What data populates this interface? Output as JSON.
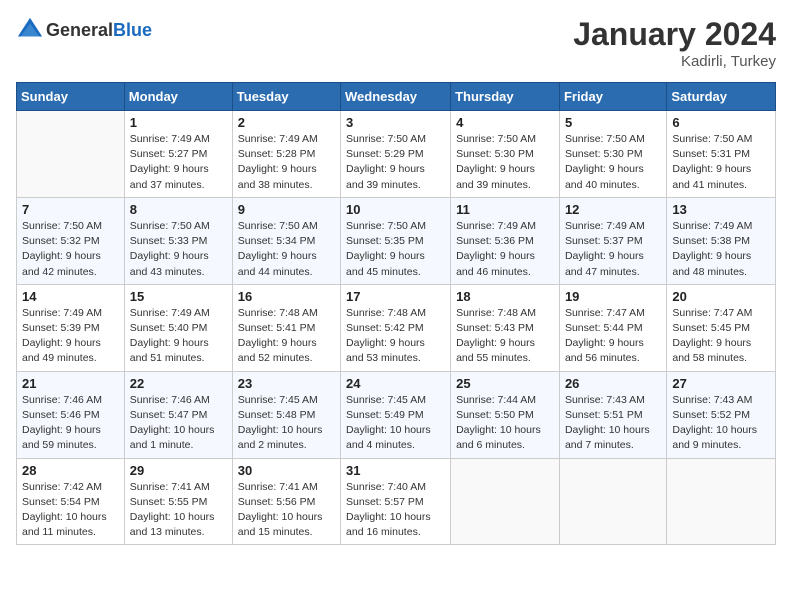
{
  "header": {
    "logo_general": "General",
    "logo_blue": "Blue",
    "title": "January 2024",
    "location": "Kadirli, Turkey"
  },
  "weekdays": [
    "Sunday",
    "Monday",
    "Tuesday",
    "Wednesday",
    "Thursday",
    "Friday",
    "Saturday"
  ],
  "weeks": [
    [
      {
        "day": "",
        "info": ""
      },
      {
        "day": "1",
        "info": "Sunrise: 7:49 AM\nSunset: 5:27 PM\nDaylight: 9 hours\nand 37 minutes."
      },
      {
        "day": "2",
        "info": "Sunrise: 7:49 AM\nSunset: 5:28 PM\nDaylight: 9 hours\nand 38 minutes."
      },
      {
        "day": "3",
        "info": "Sunrise: 7:50 AM\nSunset: 5:29 PM\nDaylight: 9 hours\nand 39 minutes."
      },
      {
        "day": "4",
        "info": "Sunrise: 7:50 AM\nSunset: 5:30 PM\nDaylight: 9 hours\nand 39 minutes."
      },
      {
        "day": "5",
        "info": "Sunrise: 7:50 AM\nSunset: 5:30 PM\nDaylight: 9 hours\nand 40 minutes."
      },
      {
        "day": "6",
        "info": "Sunrise: 7:50 AM\nSunset: 5:31 PM\nDaylight: 9 hours\nand 41 minutes."
      }
    ],
    [
      {
        "day": "7",
        "info": "Sunrise: 7:50 AM\nSunset: 5:32 PM\nDaylight: 9 hours\nand 42 minutes."
      },
      {
        "day": "8",
        "info": "Sunrise: 7:50 AM\nSunset: 5:33 PM\nDaylight: 9 hours\nand 43 minutes."
      },
      {
        "day": "9",
        "info": "Sunrise: 7:50 AM\nSunset: 5:34 PM\nDaylight: 9 hours\nand 44 minutes."
      },
      {
        "day": "10",
        "info": "Sunrise: 7:50 AM\nSunset: 5:35 PM\nDaylight: 9 hours\nand 45 minutes."
      },
      {
        "day": "11",
        "info": "Sunrise: 7:49 AM\nSunset: 5:36 PM\nDaylight: 9 hours\nand 46 minutes."
      },
      {
        "day": "12",
        "info": "Sunrise: 7:49 AM\nSunset: 5:37 PM\nDaylight: 9 hours\nand 47 minutes."
      },
      {
        "day": "13",
        "info": "Sunrise: 7:49 AM\nSunset: 5:38 PM\nDaylight: 9 hours\nand 48 minutes."
      }
    ],
    [
      {
        "day": "14",
        "info": "Sunrise: 7:49 AM\nSunset: 5:39 PM\nDaylight: 9 hours\nand 49 minutes."
      },
      {
        "day": "15",
        "info": "Sunrise: 7:49 AM\nSunset: 5:40 PM\nDaylight: 9 hours\nand 51 minutes."
      },
      {
        "day": "16",
        "info": "Sunrise: 7:48 AM\nSunset: 5:41 PM\nDaylight: 9 hours\nand 52 minutes."
      },
      {
        "day": "17",
        "info": "Sunrise: 7:48 AM\nSunset: 5:42 PM\nDaylight: 9 hours\nand 53 minutes."
      },
      {
        "day": "18",
        "info": "Sunrise: 7:48 AM\nSunset: 5:43 PM\nDaylight: 9 hours\nand 55 minutes."
      },
      {
        "day": "19",
        "info": "Sunrise: 7:47 AM\nSunset: 5:44 PM\nDaylight: 9 hours\nand 56 minutes."
      },
      {
        "day": "20",
        "info": "Sunrise: 7:47 AM\nSunset: 5:45 PM\nDaylight: 9 hours\nand 58 minutes."
      }
    ],
    [
      {
        "day": "21",
        "info": "Sunrise: 7:46 AM\nSunset: 5:46 PM\nDaylight: 9 hours\nand 59 minutes."
      },
      {
        "day": "22",
        "info": "Sunrise: 7:46 AM\nSunset: 5:47 PM\nDaylight: 10 hours\nand 1 minute."
      },
      {
        "day": "23",
        "info": "Sunrise: 7:45 AM\nSunset: 5:48 PM\nDaylight: 10 hours\nand 2 minutes."
      },
      {
        "day": "24",
        "info": "Sunrise: 7:45 AM\nSunset: 5:49 PM\nDaylight: 10 hours\nand 4 minutes."
      },
      {
        "day": "25",
        "info": "Sunrise: 7:44 AM\nSunset: 5:50 PM\nDaylight: 10 hours\nand 6 minutes."
      },
      {
        "day": "26",
        "info": "Sunrise: 7:43 AM\nSunset: 5:51 PM\nDaylight: 10 hours\nand 7 minutes."
      },
      {
        "day": "27",
        "info": "Sunrise: 7:43 AM\nSunset: 5:52 PM\nDaylight: 10 hours\nand 9 minutes."
      }
    ],
    [
      {
        "day": "28",
        "info": "Sunrise: 7:42 AM\nSunset: 5:54 PM\nDaylight: 10 hours\nand 11 minutes."
      },
      {
        "day": "29",
        "info": "Sunrise: 7:41 AM\nSunset: 5:55 PM\nDaylight: 10 hours\nand 13 minutes."
      },
      {
        "day": "30",
        "info": "Sunrise: 7:41 AM\nSunset: 5:56 PM\nDaylight: 10 hours\nand 15 minutes."
      },
      {
        "day": "31",
        "info": "Sunrise: 7:40 AM\nSunset: 5:57 PM\nDaylight: 10 hours\nand 16 minutes."
      },
      {
        "day": "",
        "info": ""
      },
      {
        "day": "",
        "info": ""
      },
      {
        "day": "",
        "info": ""
      }
    ]
  ]
}
